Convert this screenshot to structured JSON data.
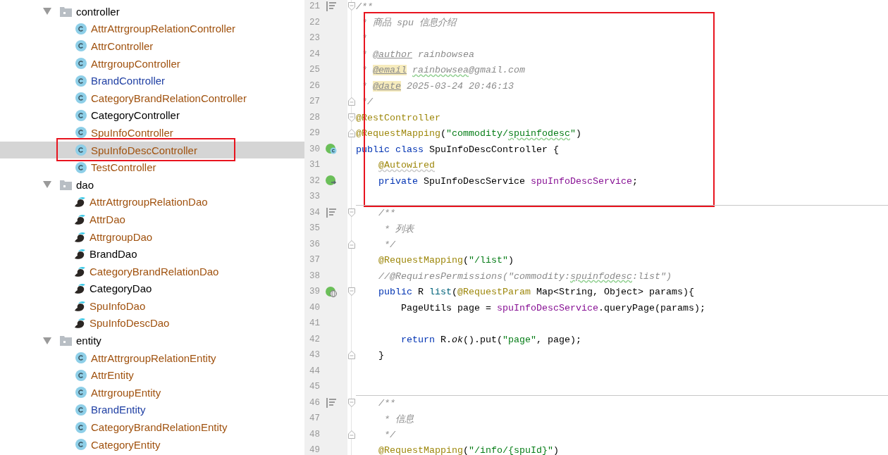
{
  "project_tree": {
    "folders": [
      {
        "label": "controller",
        "expanded": true,
        "children": [
          {
            "label": "AttrAttrgroupRelationController",
            "kind": "class",
            "color": "#a0520f",
            "selected": false
          },
          {
            "label": "AttrController",
            "kind": "class",
            "color": "#a0520f",
            "selected": false
          },
          {
            "label": "AttrgroupController",
            "kind": "class",
            "color": "#a0520f",
            "selected": false
          },
          {
            "label": "BrandController",
            "kind": "class",
            "color": "#1f3fa3",
            "selected": false
          },
          {
            "label": "CategoryBrandRelationController",
            "kind": "class",
            "color": "#a0520f",
            "selected": false
          },
          {
            "label": "CategoryController",
            "kind": "class",
            "color": "#000000",
            "selected": false
          },
          {
            "label": "SpuInfoController",
            "kind": "class",
            "color": "#a0520f",
            "selected": false
          },
          {
            "label": "SpuInfoDescController",
            "kind": "class",
            "color": "#a0520f",
            "selected": true,
            "outlined": true
          },
          {
            "label": "TestController",
            "kind": "class",
            "color": "#a0520f",
            "selected": false
          }
        ]
      },
      {
        "label": "dao",
        "expanded": true,
        "children": [
          {
            "label": "AttrAttrgroupRelationDao",
            "kind": "dao",
            "color": "#a0520f",
            "selected": false
          },
          {
            "label": "AttrDao",
            "kind": "dao",
            "color": "#a0520f",
            "selected": false
          },
          {
            "label": "AttrgroupDao",
            "kind": "dao",
            "color": "#a0520f",
            "selected": false
          },
          {
            "label": "BrandDao",
            "kind": "dao",
            "color": "#000000",
            "selected": false
          },
          {
            "label": "CategoryBrandRelationDao",
            "kind": "dao",
            "color": "#a0520f",
            "selected": false
          },
          {
            "label": "CategoryDao",
            "kind": "dao",
            "color": "#000000",
            "selected": false
          },
          {
            "label": "SpuInfoDao",
            "kind": "dao",
            "color": "#a0520f",
            "selected": false
          },
          {
            "label": "SpuInfoDescDao",
            "kind": "dao",
            "color": "#a0520f",
            "selected": false
          }
        ]
      },
      {
        "label": "entity",
        "expanded": true,
        "children": [
          {
            "label": "AttrAttrgroupRelationEntity",
            "kind": "class",
            "color": "#a0520f",
            "selected": false
          },
          {
            "label": "AttrEntity",
            "kind": "class",
            "color": "#a0520f",
            "selected": false
          },
          {
            "label": "AttrgroupEntity",
            "kind": "class",
            "color": "#a0520f",
            "selected": false
          },
          {
            "label": "BrandEntity",
            "kind": "class",
            "color": "#1f3fa3",
            "selected": false
          },
          {
            "label": "CategoryBrandRelationEntity",
            "kind": "class",
            "color": "#a0520f",
            "selected": false
          },
          {
            "label": "CategoryEntity",
            "kind": "class",
            "color": "#a0520f",
            "selected": false
          }
        ]
      }
    ]
  },
  "editor": {
    "blocks": [
      {
        "lines": [
          {
            "number": "21",
            "gutter_icon": {
              "kind": "docs"
            },
            "fold_marker": {
              "kind": "start"
            },
            "tokens": [
              {
                "kind": "comment",
                "text": "/**"
              }
            ]
          }
        ]
      },
      {
        "outlined": true,
        "lines": [
          {
            "number": "22",
            "tokens": [
              {
                "kind": "comment",
                "text": " * 商品 spu 信息介绍"
              }
            ]
          },
          {
            "number": "23",
            "tokens": [
              {
                "kind": "comment",
                "text": " *"
              }
            ]
          },
          {
            "number": "24",
            "tokens": [
              {
                "kind": "comment",
                "text": " * "
              },
              {
                "kind": "doctag",
                "text": "@author"
              },
              {
                "kind": "comment",
                "text": " rainbowsea"
              }
            ]
          },
          {
            "number": "25",
            "tokens": [
              {
                "kind": "comment",
                "text": " * "
              },
              {
                "kind": "doctag-marked",
                "text": "@email"
              },
              {
                "kind": "comment-typo",
                "text": " rainbowsea"
              },
              {
                "kind": "comment",
                "text": "@gmail.com"
              }
            ]
          },
          {
            "number": "26",
            "tokens": [
              {
                "kind": "comment",
                "text": " * "
              },
              {
                "kind": "doctag-marked",
                "text": "@date"
              },
              {
                "kind": "comment",
                "text": " 2025-03-24 20:46:13"
              }
            ]
          },
          {
            "number": "27",
            "fold_marker": {
              "kind": "end"
            },
            "tokens": [
              {
                "kind": "comment",
                "text": " */"
              }
            ]
          },
          {
            "number": "28",
            "fold_marker": {
              "kind": "start"
            },
            "tokens": [
              {
                "kind": "annotation",
                "text": "@RestController"
              }
            ]
          },
          {
            "number": "29",
            "fold_marker": {
              "kind": "end"
            },
            "tokens": [
              {
                "kind": "annotation",
                "text": "@RequestMapping"
              },
              {
                "kind": "plain",
                "text": "("
              },
              {
                "kind": "string",
                "text": "\"commodity/"
              },
              {
                "kind": "string-typo",
                "text": "spuinfodesc"
              },
              {
                "kind": "string",
                "text": "\""
              },
              {
                "kind": "plain",
                "text": ")"
              }
            ]
          },
          {
            "number": "30",
            "gutter_icon": {
              "kind": "bean"
            },
            "tokens": [
              {
                "kind": "keyword",
                "text": "public class"
              },
              {
                "kind": "plain",
                "text": " SpuInfoDescController {"
              }
            ]
          },
          {
            "number": "31",
            "tokens": [
              {
                "kind": "annotation-typo",
                "text": "    @Autowired"
              }
            ]
          },
          {
            "number": "32",
            "gutter_icon": {
              "kind": "autowire"
            },
            "tokens": [
              {
                "kind": "keyword",
                "text": "    private"
              },
              {
                "kind": "plain",
                "text": " SpuInfoDescService "
              },
              {
                "kind": "field",
                "text": "spuInfoDescService"
              },
              {
                "kind": "plain",
                "text": ";"
              }
            ]
          },
          {
            "number": "33"
          }
        ]
      },
      {
        "lines": [
          {
            "number": "34",
            "separator_above": true,
            "gutter_icon": {
              "kind": "docs"
            },
            "fold_marker": {
              "kind": "start"
            },
            "tokens": [
              {
                "kind": "comment",
                "text": "    /**"
              }
            ]
          },
          {
            "number": "35",
            "tokens": [
              {
                "kind": "comment",
                "text": "     * 列表"
              }
            ]
          },
          {
            "number": "36",
            "fold_marker": {
              "kind": "end"
            },
            "tokens": [
              {
                "kind": "comment",
                "text": "     */"
              }
            ]
          },
          {
            "number": "37",
            "tokens": [
              {
                "kind": "annotation",
                "text": "    @RequestMapping"
              },
              {
                "kind": "plain",
                "text": "("
              },
              {
                "kind": "string",
                "text": "\"/list\""
              },
              {
                "kind": "plain",
                "text": ")"
              }
            ]
          },
          {
            "number": "38",
            "tokens": [
              {
                "kind": "comment",
                "text": "    //@RequiresPermissions(\"commodity:"
              },
              {
                "kind": "comment-typo",
                "text": "spuinfodesc"
              },
              {
                "kind": "comment",
                "text": ":list\")"
              }
            ]
          },
          {
            "number": "39",
            "gutter_icon": {
              "kind": "web"
            },
            "fold_marker": {
              "kind": "start"
            },
            "tokens": [
              {
                "kind": "keyword",
                "text": "    public"
              },
              {
                "kind": "plain",
                "text": " R "
              },
              {
                "kind": "method",
                "text": "list"
              },
              {
                "kind": "plain",
                "text": "("
              },
              {
                "kind": "annotation",
                "text": "@RequestParam"
              },
              {
                "kind": "plain",
                "text": " Map<String, Object> params){"
              }
            ]
          },
          {
            "number": "40",
            "tokens": [
              {
                "kind": "plain",
                "text": "        PageUtils page = "
              },
              {
                "kind": "field",
                "text": "spuInfoDescService"
              },
              {
                "kind": "plain",
                "text": ".queryPage(params);"
              }
            ]
          },
          {
            "number": "41"
          },
          {
            "number": "42",
            "tokens": [
              {
                "kind": "keyword",
                "text": "        return"
              },
              {
                "kind": "plain",
                "text": " R."
              },
              {
                "kind": "italic",
                "text": "ok"
              },
              {
                "kind": "plain",
                "text": "().put("
              },
              {
                "kind": "string",
                "text": "\"page\""
              },
              {
                "kind": "plain",
                "text": ", page);"
              }
            ]
          },
          {
            "number": "43",
            "fold_marker": {
              "kind": "end"
            },
            "tokens": [
              {
                "kind": "plain",
                "text": "    }"
              }
            ]
          },
          {
            "number": "44"
          },
          {
            "number": "45"
          },
          {
            "number": "46",
            "separator_above": true,
            "gutter_icon": {
              "kind": "docs"
            },
            "fold_marker": {
              "kind": "start"
            },
            "tokens": [
              {
                "kind": "comment",
                "text": "    /**"
              }
            ]
          },
          {
            "number": "47",
            "tokens": [
              {
                "kind": "comment",
                "text": "     * 信息"
              }
            ]
          },
          {
            "number": "48",
            "fold_marker": {
              "kind": "end"
            },
            "tokens": [
              {
                "kind": "comment",
                "text": "     */"
              }
            ]
          },
          {
            "number": "49",
            "tokens": [
              {
                "kind": "annotation",
                "text": "    @RequestMapping"
              },
              {
                "kind": "plain",
                "text": "("
              },
              {
                "kind": "string",
                "text": "\"/info/{spuId}\""
              },
              {
                "kind": "plain",
                "text": ")"
              }
            ]
          }
        ]
      }
    ]
  }
}
